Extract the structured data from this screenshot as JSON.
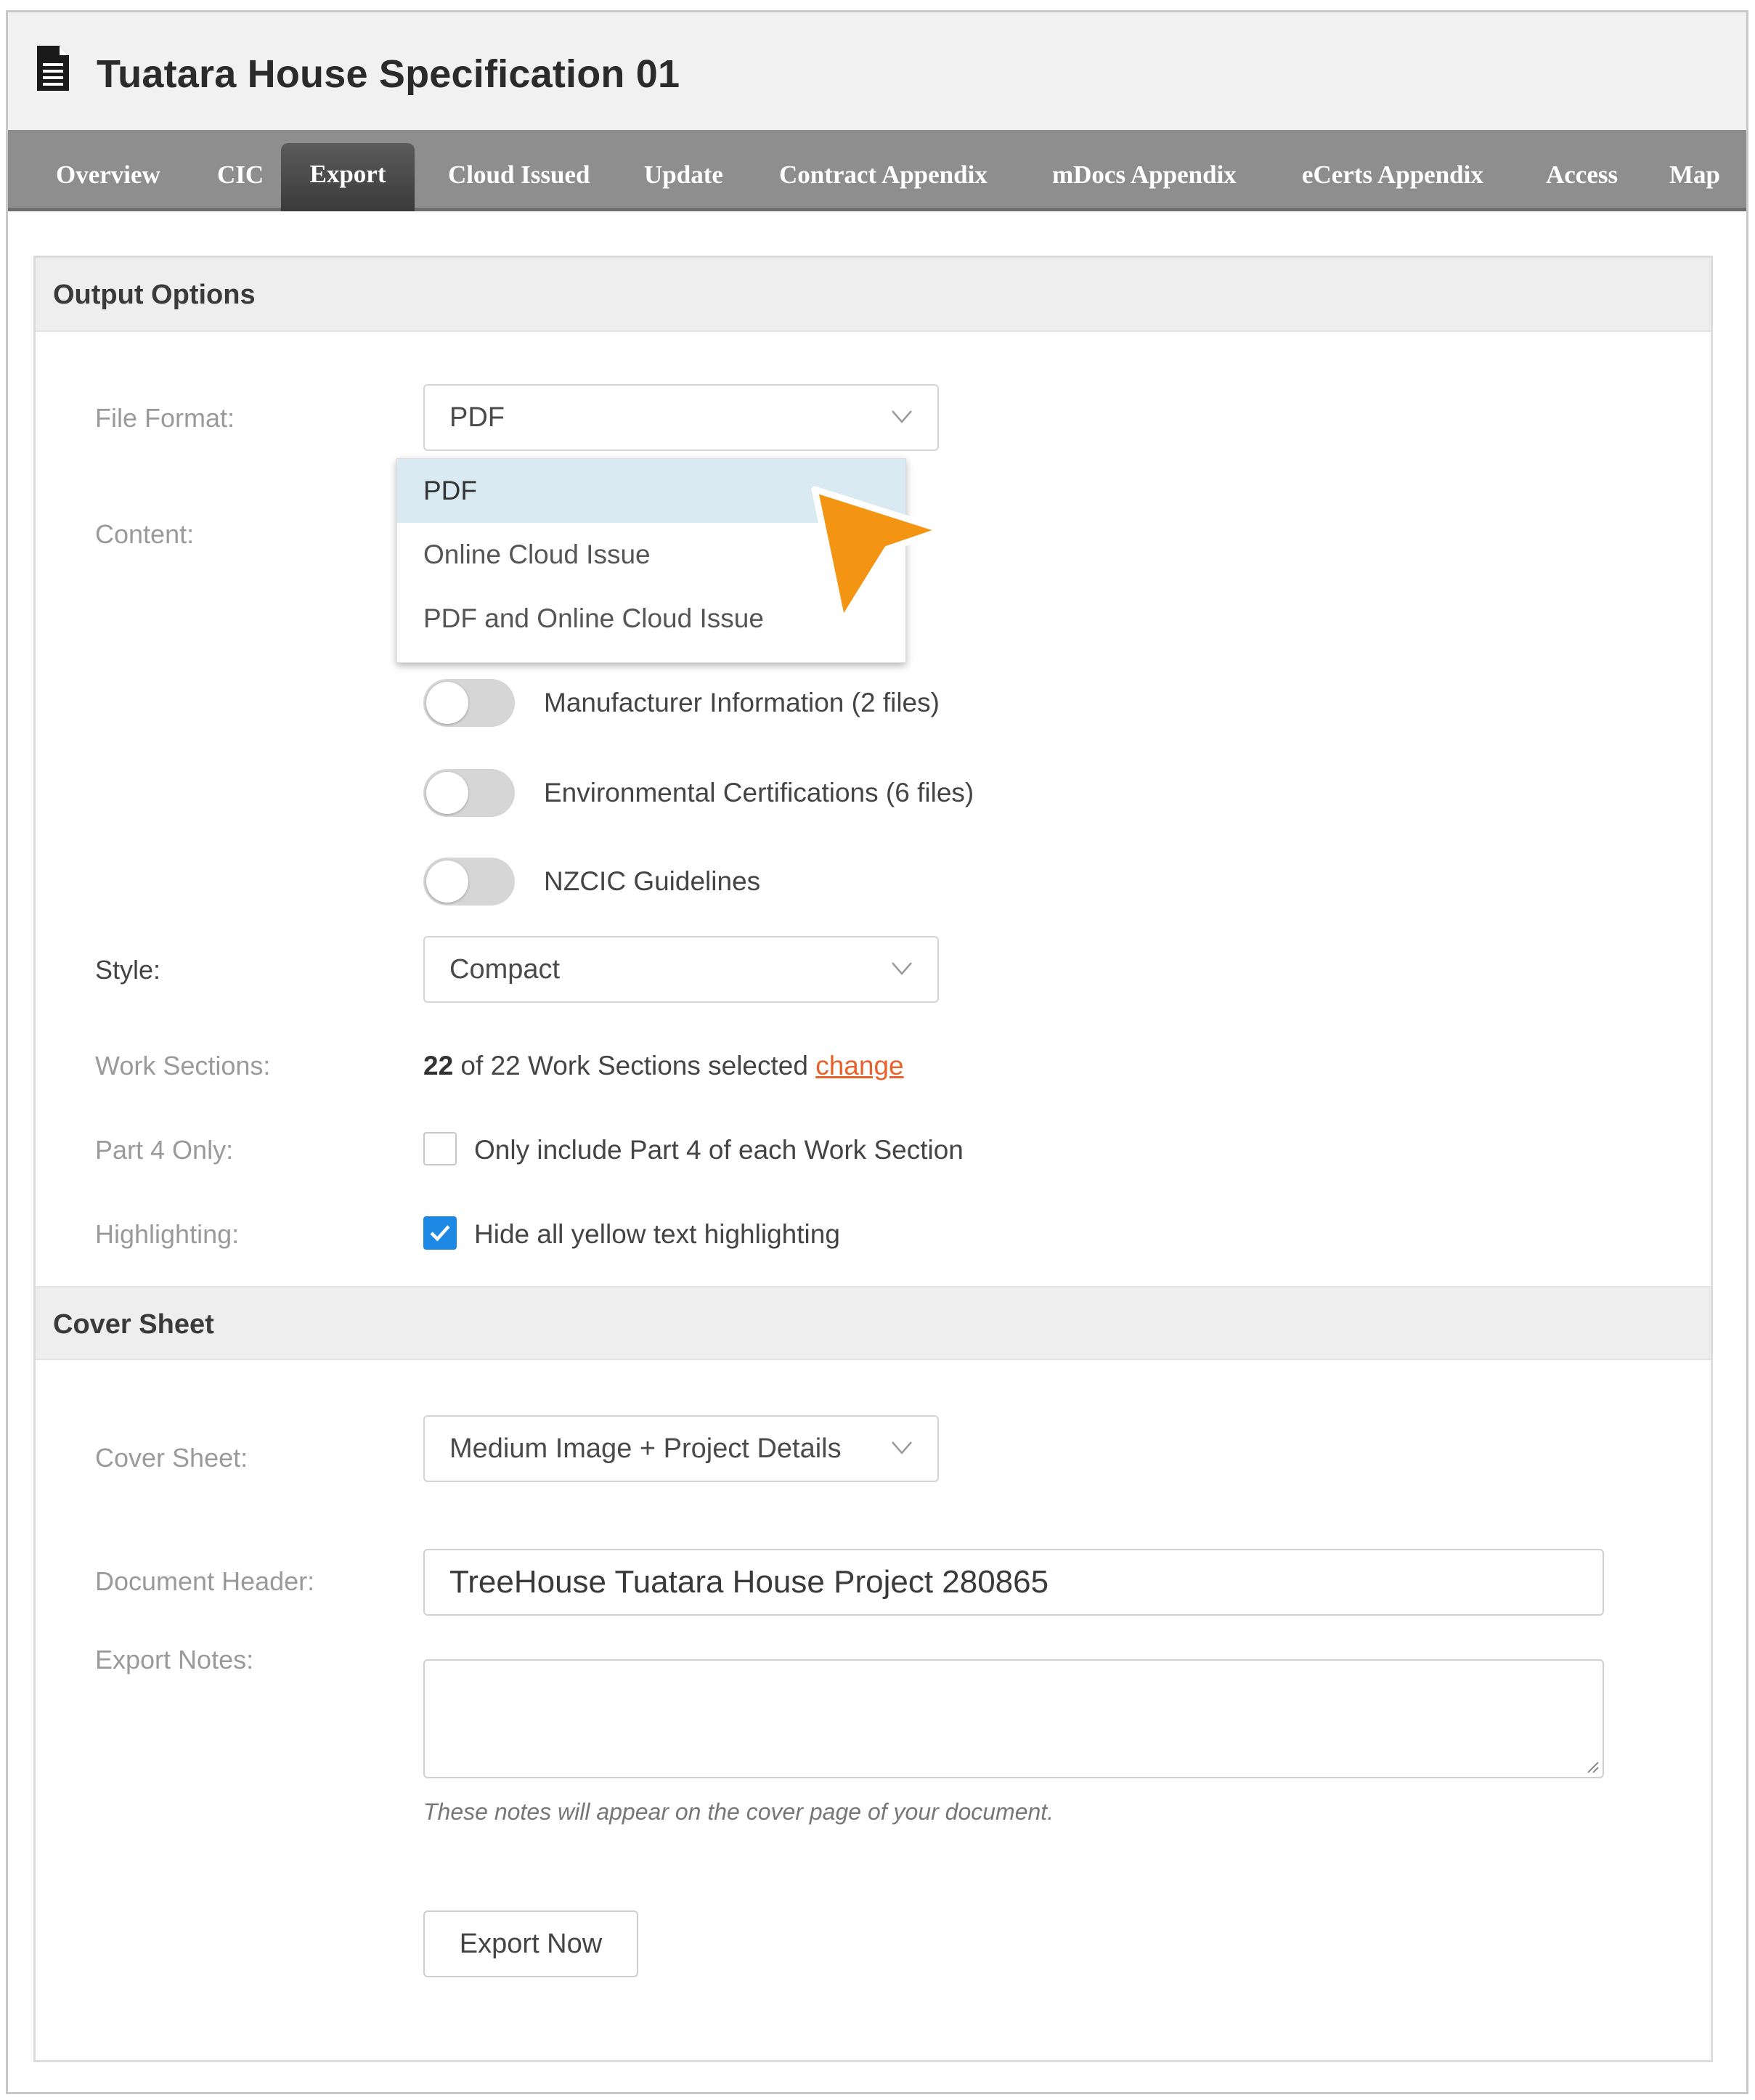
{
  "header": {
    "title": "Tuatara House Specification 01",
    "icon": "document-icon"
  },
  "tabs": [
    {
      "label": "Overview",
      "active": false
    },
    {
      "label": "CIC",
      "active": false
    },
    {
      "label": "Export",
      "active": true
    },
    {
      "label": "Cloud Issued",
      "active": false
    },
    {
      "label": "Update",
      "active": false
    },
    {
      "label": "Contract Appendix",
      "active": false
    },
    {
      "label": "mDocs Appendix",
      "active": false
    },
    {
      "label": "eCerts Appendix",
      "active": false
    },
    {
      "label": "Access",
      "active": false
    },
    {
      "label": "Map",
      "active": false
    }
  ],
  "output_options": {
    "heading": "Output Options",
    "file_format": {
      "label": "File Format:",
      "value": "PDF",
      "options": [
        "PDF",
        "Online Cloud Issue",
        "PDF and Online Cloud Issue"
      ],
      "highlighted_option": "PDF"
    },
    "content": {
      "label": "Content:",
      "toggles": [
        {
          "label": "Manufacturer Information (2 files)",
          "on": false
        },
        {
          "label": "Environmental Certifications (6 files)",
          "on": false
        },
        {
          "label": "NZCIC Guidelines",
          "on": false
        }
      ]
    },
    "style": {
      "label": "Style:",
      "value": "Compact"
    },
    "work_sections": {
      "label": "Work Sections:",
      "selected": "22",
      "text": " of 22 Work Sections selected ",
      "link": "change"
    },
    "part4": {
      "label": "Part 4 Only:",
      "text": "Only include Part 4 of each Work Section",
      "checked": false
    },
    "highlighting": {
      "label": "Highlighting:",
      "text": "Hide all yellow text highlighting",
      "checked": true
    }
  },
  "cover_sheet": {
    "heading": "Cover Sheet",
    "cover_sheet": {
      "label": "Cover Sheet:",
      "value": "Medium Image + Project Details"
    },
    "document_header": {
      "label": "Document Header:",
      "value": "TreeHouse Tuatara House Project 280865"
    },
    "export_notes": {
      "label": "Export Notes:",
      "value": "",
      "help": "These notes will appear on the cover page of your document."
    },
    "export_button": "Export Now"
  },
  "colors": {
    "accent_blue": "#1e88e5",
    "link_orange": "#e8632b",
    "pointer_orange": "#f39512",
    "selected_option_bg": "#d9eaf3"
  }
}
